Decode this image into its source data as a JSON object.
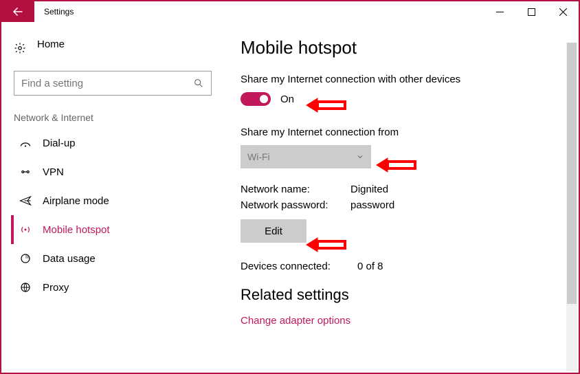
{
  "window": {
    "title": "Settings"
  },
  "sidebar": {
    "home": "Home",
    "search_placeholder": "Find a setting",
    "section": "Network & Internet",
    "items": [
      {
        "label": "Dial-up",
        "name": "dial-up"
      },
      {
        "label": "VPN",
        "name": "vpn"
      },
      {
        "label": "Airplane mode",
        "name": "airplane-mode"
      },
      {
        "label": "Mobile hotspot",
        "name": "mobile-hotspot",
        "active": true
      },
      {
        "label": "Data usage",
        "name": "data-usage"
      },
      {
        "label": "Proxy",
        "name": "proxy"
      }
    ]
  },
  "main": {
    "heading": "Mobile hotspot",
    "share_label": "Share my Internet connection with other devices",
    "toggle_state": "On",
    "share_from_label": "Share my Internet connection from",
    "share_from_value": "Wi-Fi",
    "network_name_label": "Network name:",
    "network_name_value": "Dignited",
    "network_password_label": "Network password:",
    "network_password_value": "password",
    "edit_label": "Edit",
    "devices_connected_label": "Devices connected:",
    "devices_connected_value": "0 of 8",
    "related_heading": "Related settings",
    "related_link": "Change adapter options"
  },
  "colors": {
    "accent": "#c2185b",
    "titlebar_back": "#b21041"
  }
}
